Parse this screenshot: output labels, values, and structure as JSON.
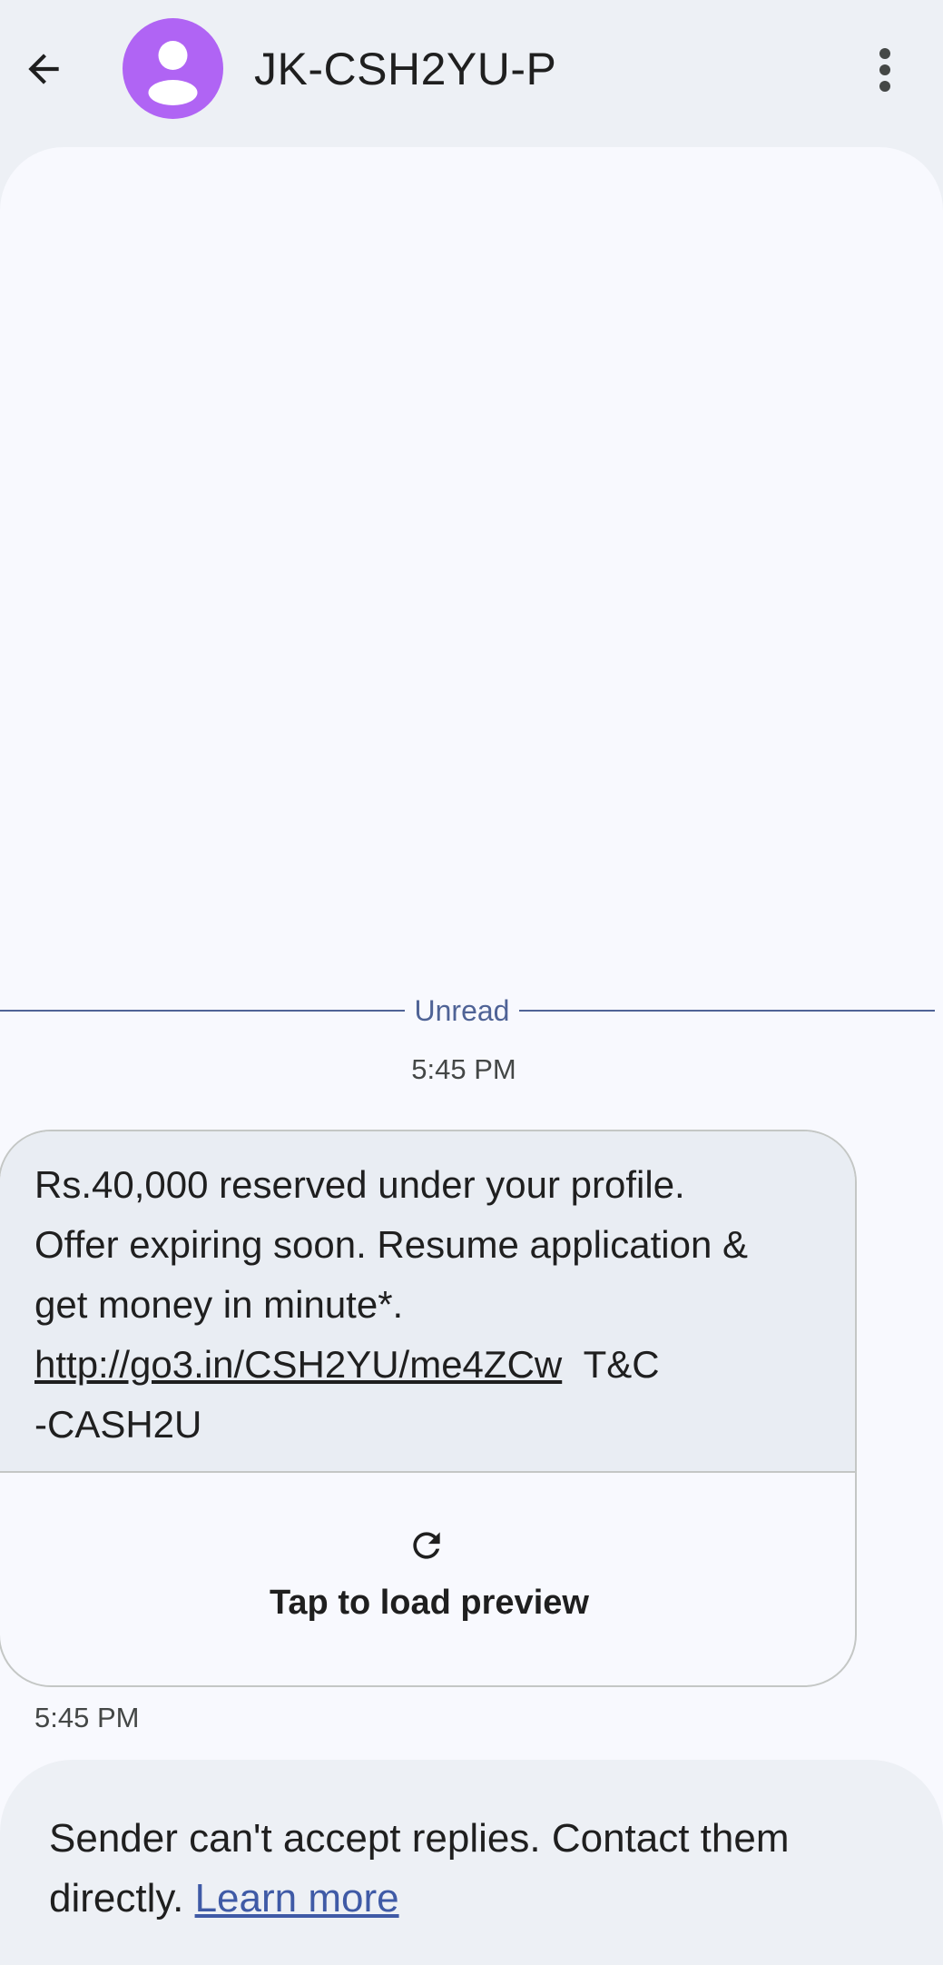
{
  "header": {
    "title": "JK-CSH2YU-P",
    "back_icon": "arrow-left-icon",
    "avatar_icon": "person-icon",
    "avatar_color": "#b064f4",
    "more_icon": "more-vert-icon"
  },
  "conversation": {
    "unread_label": "Unread",
    "message_time": "5:45 PM",
    "message": {
      "line1": "Rs.40,000 reserved under your profile.",
      "line2": "Offer expiring soon. Resume application &",
      "line3": "get money in minute*.",
      "link": "http://go3.in/CSH2YU/me4ZCw",
      "after_link": "T&C",
      "line5": "-CASH2U"
    },
    "preview": {
      "icon": "refresh-icon",
      "label": "Tap to load preview"
    },
    "sent_time": "5:45 PM"
  },
  "footer": {
    "text": "Sender can't accept replies. Contact them directly.",
    "link_label": "Learn more",
    "link_color": "#3f5aa6"
  }
}
